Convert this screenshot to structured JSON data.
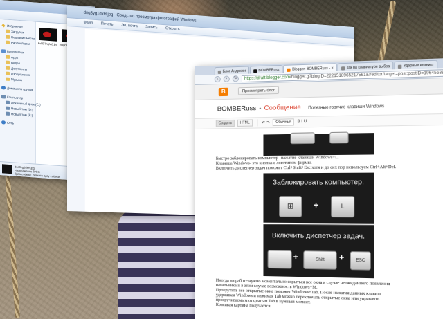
{
  "explorer": {
    "nav_items": [
      {
        "label": "Избранное",
        "icon": "star-icon",
        "indent": false
      },
      {
        "label": "Загрузки",
        "icon": "folder-icon",
        "indent": true
      },
      {
        "label": "Недавние места",
        "icon": "folder-icon",
        "indent": true
      },
      {
        "label": "Рабочий стол",
        "icon": "folder-icon",
        "indent": true
      },
      {
        "label": "Библиотеки",
        "icon": "library-icon",
        "indent": false,
        "gap": true
      },
      {
        "label": "Apps",
        "icon": "folder-icon",
        "indent": true
      },
      {
        "label": "Видео",
        "icon": "folder-icon",
        "indent": true
      },
      {
        "label": "Документы",
        "icon": "folder-icon",
        "indent": true
      },
      {
        "label": "Изображения",
        "icon": "folder-icon",
        "indent": true
      },
      {
        "label": "Музыка",
        "icon": "folder-icon",
        "indent": true
      },
      {
        "label": "Домашняя группа",
        "icon": "homegroup-icon",
        "indent": false,
        "gap": true
      },
      {
        "label": "Компьютер",
        "icon": "computer-icon",
        "indent": false,
        "gap": true
      },
      {
        "label": "Локальный диск (C:)",
        "icon": "drive-icon",
        "indent": true
      },
      {
        "label": "Новый том (D:)",
        "icon": "drive-icon",
        "indent": true
      },
      {
        "label": "Новый том (E:)",
        "icon": "drive-icon",
        "indent": true
      },
      {
        "label": "Сеть",
        "icon": "network-icon",
        "indent": false,
        "gap": true
      }
    ],
    "files": [
      {
        "name": "6xk5l7ngVj8.jpg"
      },
      {
        "name": "eOpbXvsFaoEx.jpg"
      }
    ],
    "details": {
      "line1": "dnq3yg1dxH.jpg",
      "line2": "Изображение JPEG",
      "line3": "Дата съёмки: Укажите дату съёмки"
    }
  },
  "viewer": {
    "title": "dnq3yg1dxH.jpg - Средство просмотра фотографий Windows",
    "menu": [
      "Файл",
      "Печать",
      "Эл. почта",
      "Запись",
      "Открыть"
    ]
  },
  "chrome": {
    "tabs": [
      {
        "label": "Блог Андрюхи",
        "icon": "page-icon",
        "active": false
      },
      {
        "label": "BOMBERuss",
        "icon": "black-square-icon",
        "active": false
      },
      {
        "label": "Blogger: BOMBERuss - ×",
        "icon": "blogger-icon",
        "active": true
      },
      {
        "label": "как на клавиатуре выбра",
        "icon": "page-icon",
        "active": false
      },
      {
        "label": "Ударные клавиш",
        "icon": "page-icon",
        "active": false
      }
    ],
    "url_host": "https://draft.blogger.com",
    "url_path": "/blogger.g?blogID=2221518965217561&#editor/target=post;postID=1964553862816"
  },
  "blogger": {
    "logo_letter": "B",
    "view_blog_label": "Просмотреть блог",
    "blog_name": "BOMBERuss",
    "section": "Сообщение",
    "post_title": "Полезные горячие клавиши Windows",
    "compose_label": "Создать",
    "html_label": "HTML",
    "format_select": "Обычный",
    "undo_glyph": "↶ ↷",
    "format_glyphs": "B I U"
  },
  "post": {
    "para1": [
      "Быстро заблокировать компьютер- нажатие клавиши Windows+L.",
      "Клавиша Windows- это кнопка с логотипом фирмы.",
      "Включить диспетчер задач поможет Ctrl+Shift+Esc хотя и до сих пор используем Ctrl+Alt+Del."
    ],
    "img1_label": "Заблокировать компьютер.",
    "img1_key_right": "L",
    "img2_label": "Включить диспетчер задач.",
    "img2_key_mid": "Shift",
    "img2_key_right": "ESC",
    "plus": "+",
    "para2": [
      "Иногда на работе нужно моментально скрыться все окна в случае неожиданного появления",
      "начальника и в этом случае возможность Windows+M.",
      "Прокрутить все открытые окна поможет Windows+Tab. После нажатия данных клавиш",
      "удерживая Windows и нажимая Tab можно переключать открытые окна или управлять",
      "прокручиваемым открытым Tab в нужный момент.",
      "Красивая картина получается."
    ]
  }
}
